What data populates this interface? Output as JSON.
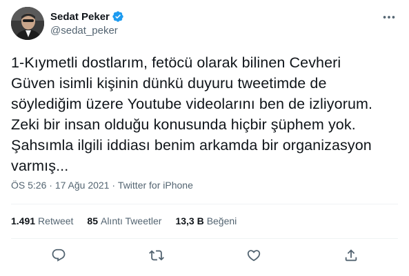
{
  "author": {
    "display_name": "Sedat Peker",
    "handle": "@sedat_peker",
    "verified_icon": "verified-badge-icon"
  },
  "tweet": {
    "text": "1-Kıymetli dostlarım, fetöcü olarak bilinen Cevheri\nGüven isimli kişinin dünkü duyuru tweetimde de\nsöylediğim üzere Youtube videolarını ben de izliyorum.\nZeki bir insan olduğu konusunda hiçbir şüphem yok.\nŞahsımla ilgili iddiası benim arkamda bir organizasyon\nvarmış...",
    "time": "ÖS 5:26",
    "separator": " · ",
    "date": "17 Ağu 2021",
    "source": "Twitter for iPhone"
  },
  "stats": {
    "retweets": {
      "value": "1.491",
      "label": "Retweet"
    },
    "quotes": {
      "value": "85",
      "label": "Alıntı Tweetler"
    },
    "likes": {
      "value": "13,3 B",
      "label": "Beğeni"
    }
  },
  "actions": [
    "reply-icon",
    "retweet-icon",
    "like-icon",
    "share-icon"
  ],
  "colors": {
    "verified": "#1d9bf0",
    "secondary_text": "#536471",
    "divider": "#eff3f4"
  }
}
